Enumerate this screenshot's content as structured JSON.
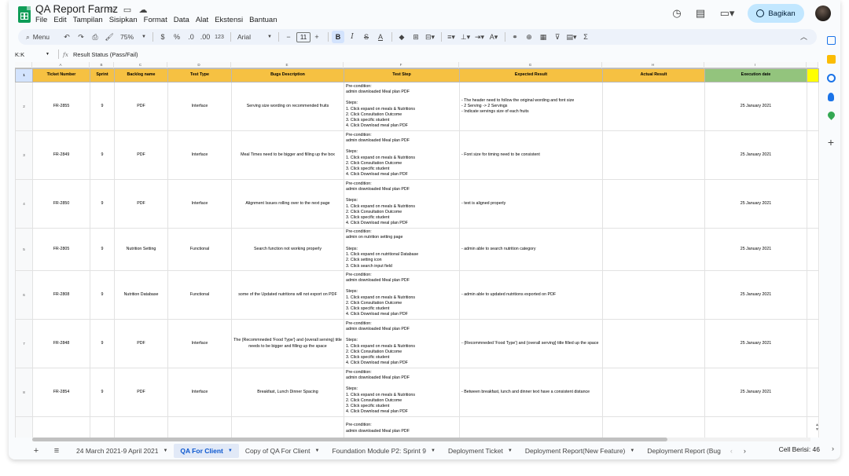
{
  "app": {
    "title": "QA Report Farmz",
    "menu": [
      "File",
      "Edit",
      "Tampilan",
      "Sisipkan",
      "Format",
      "Data",
      "Alat",
      "Ekstensi",
      "Bantuan"
    ],
    "share_label": "Bagikan"
  },
  "toolbar": {
    "search_label": "Menu",
    "zoom": "75%",
    "currency": "$",
    "percent": "%",
    "dec_decrease": ".0",
    "dec_increase": ".00",
    "number_format": "123",
    "font": "Arial",
    "font_size": "11"
  },
  "formula_bar": {
    "name_box": "K:K",
    "fx": "fx",
    "content": "Result Status (Pass/Fail)"
  },
  "colors": {
    "header_yellow": "#f6c142",
    "exec_green": "#93c47d",
    "active_tab": "#0b57d0",
    "share_bg": "#c2e7ff"
  },
  "sheet": {
    "column_letters": [
      "A",
      "B",
      "C",
      "D",
      "E",
      "F",
      "G",
      "H",
      "I"
    ],
    "headers": [
      "Ticket Number",
      "Sprint",
      "Backlog name",
      "Test Type",
      "Bugs Description",
      "Test Step",
      "Expected Result",
      "Actual Result",
      "Execution date"
    ],
    "row_numbers": [
      "1",
      "2",
      "3",
      "4",
      "5",
      "6",
      "7",
      "8"
    ],
    "rows": [
      {
        "ticket": "FR-2855",
        "sprint": "9",
        "backlog": "PDF",
        "type": "Interface",
        "bug": "Serving size wording on recommended fruits",
        "steps": [
          "Pre-condition:",
          "admin downloaded Meal plan PDF",
          "",
          "Steps:",
          "1. Click expand on meals & Nutritions",
          "2. Click Consultation Outcome",
          "3. Click specific student",
          "4. Click Download meal plan PDF"
        ],
        "expected": [
          "- The header need to follow the original wording and font size",
          "- 2 Serving -> 2 Servings",
          "- Indicate servings size of each fruits"
        ],
        "date": "25 January 2021"
      },
      {
        "ticket": "FR-2849",
        "sprint": "9",
        "backlog": "PDF",
        "type": "Interface",
        "bug": "Meal Times need to be bigger and filling up the box",
        "steps": [
          "Pre-condition:",
          "admin downloaded Meal plan PDF",
          "",
          "Steps:",
          "1. Click expand on meals & Nutritions",
          "2. Click Consultation Outcome",
          "3. Click specific student",
          "4. Click Download meal plan PDF"
        ],
        "expected": [
          "- Font size for timing need to be consistent"
        ],
        "date": "25 January 2021"
      },
      {
        "ticket": "FR-2850",
        "sprint": "9",
        "backlog": "PDF",
        "type": "Interface",
        "bug": "Alignment Issues rolling over to the next page",
        "steps": [
          "Pre-condition:",
          "admin downloaded Meal plan PDF",
          "",
          "Steps:",
          "1. Click expand on meals & Nutritions",
          "2. Click Consultation Outcome",
          "3. Click specific student",
          "4. Click Download meal plan PDF"
        ],
        "expected": [
          "- text is aligned properly"
        ],
        "date": "25 January 2021"
      },
      {
        "ticket": "FR-2805",
        "sprint": "9",
        "backlog": "Nutrition Setting",
        "type": "Functional",
        "bug": "Search function not working properly",
        "steps": [
          "Pre-condition:",
          "admin on nutrition setting page",
          "",
          "Steps:",
          "1. Click expand on nutritional Database",
          "2. Click setting icon",
          "3. Click search input field"
        ],
        "expected": [
          "- admin able to search nutrition category"
        ],
        "date": "25 January 2021"
      },
      {
        "ticket": "FR-2808",
        "sprint": "9",
        "backlog": "Nutrition Database",
        "type": "Functional",
        "bug": "some of the Updated nutritions will not export on PDF",
        "steps": [
          "Pre-condition:",
          "admin downloaded Meal plan PDF",
          "",
          "Steps:",
          "1. Click expand on meals & Nutritions",
          "2. Click Consultation Outcome",
          "3. Click specific student",
          "4. Click Download meal plan PDF"
        ],
        "expected": [
          "- admin able to updated nutritions exported on PDF"
        ],
        "date": "25 January 2021"
      },
      {
        "ticket": "FR-2848",
        "sprint": "9",
        "backlog": "PDF",
        "type": "Interface",
        "bug": "The {Recommneded 'Food Type'} and {overall serving} title needs to be bigger and filling up the space",
        "steps": [
          "Pre-condition:",
          "admin downloaded Meal plan PDF",
          "",
          "Steps:",
          "1. Click expand on meals & Nutritions",
          "2. Click Consultation Outcome",
          "3. Click specific student",
          "4. Click Download meal plan PDF"
        ],
        "expected": [
          "- {Recommneded 'Food Type'} and {overall serving} title filled up the space"
        ],
        "date": "25 January 2021"
      },
      {
        "ticket": "FR-2854",
        "sprint": "9",
        "backlog": "PDF",
        "type": "Interface",
        "bug": "Breakfast, Lunch Dinner Spacing",
        "steps": [
          "Pre-condition:",
          "admin downloaded Meal plan PDF",
          "",
          "Steps:",
          "1. Click expand on meals & Nutritions",
          "2. Click Consultation Outcome",
          "3. Click specific student",
          "4. Click Download meal plan PDF"
        ],
        "expected": [
          "- Between breakfast, lunch and dinner text have a consistent distance"
        ],
        "date": "25 January 2021"
      }
    ],
    "partial_row_steps": [
      "Pre-condition:",
      "admin downloaded Meal plan PDF"
    ]
  },
  "tabs": {
    "items": [
      "24 March 2021-9 April 2021",
      "QA For Client",
      "Copy of QA For Client",
      "Foundation Module P2: Sprint 9",
      "Deployment Ticket",
      "Deployment Report(New Feature)",
      "Deployment Report (Bug"
    ],
    "active_index": 1,
    "cell_count": "Cell Berisi: 46"
  }
}
